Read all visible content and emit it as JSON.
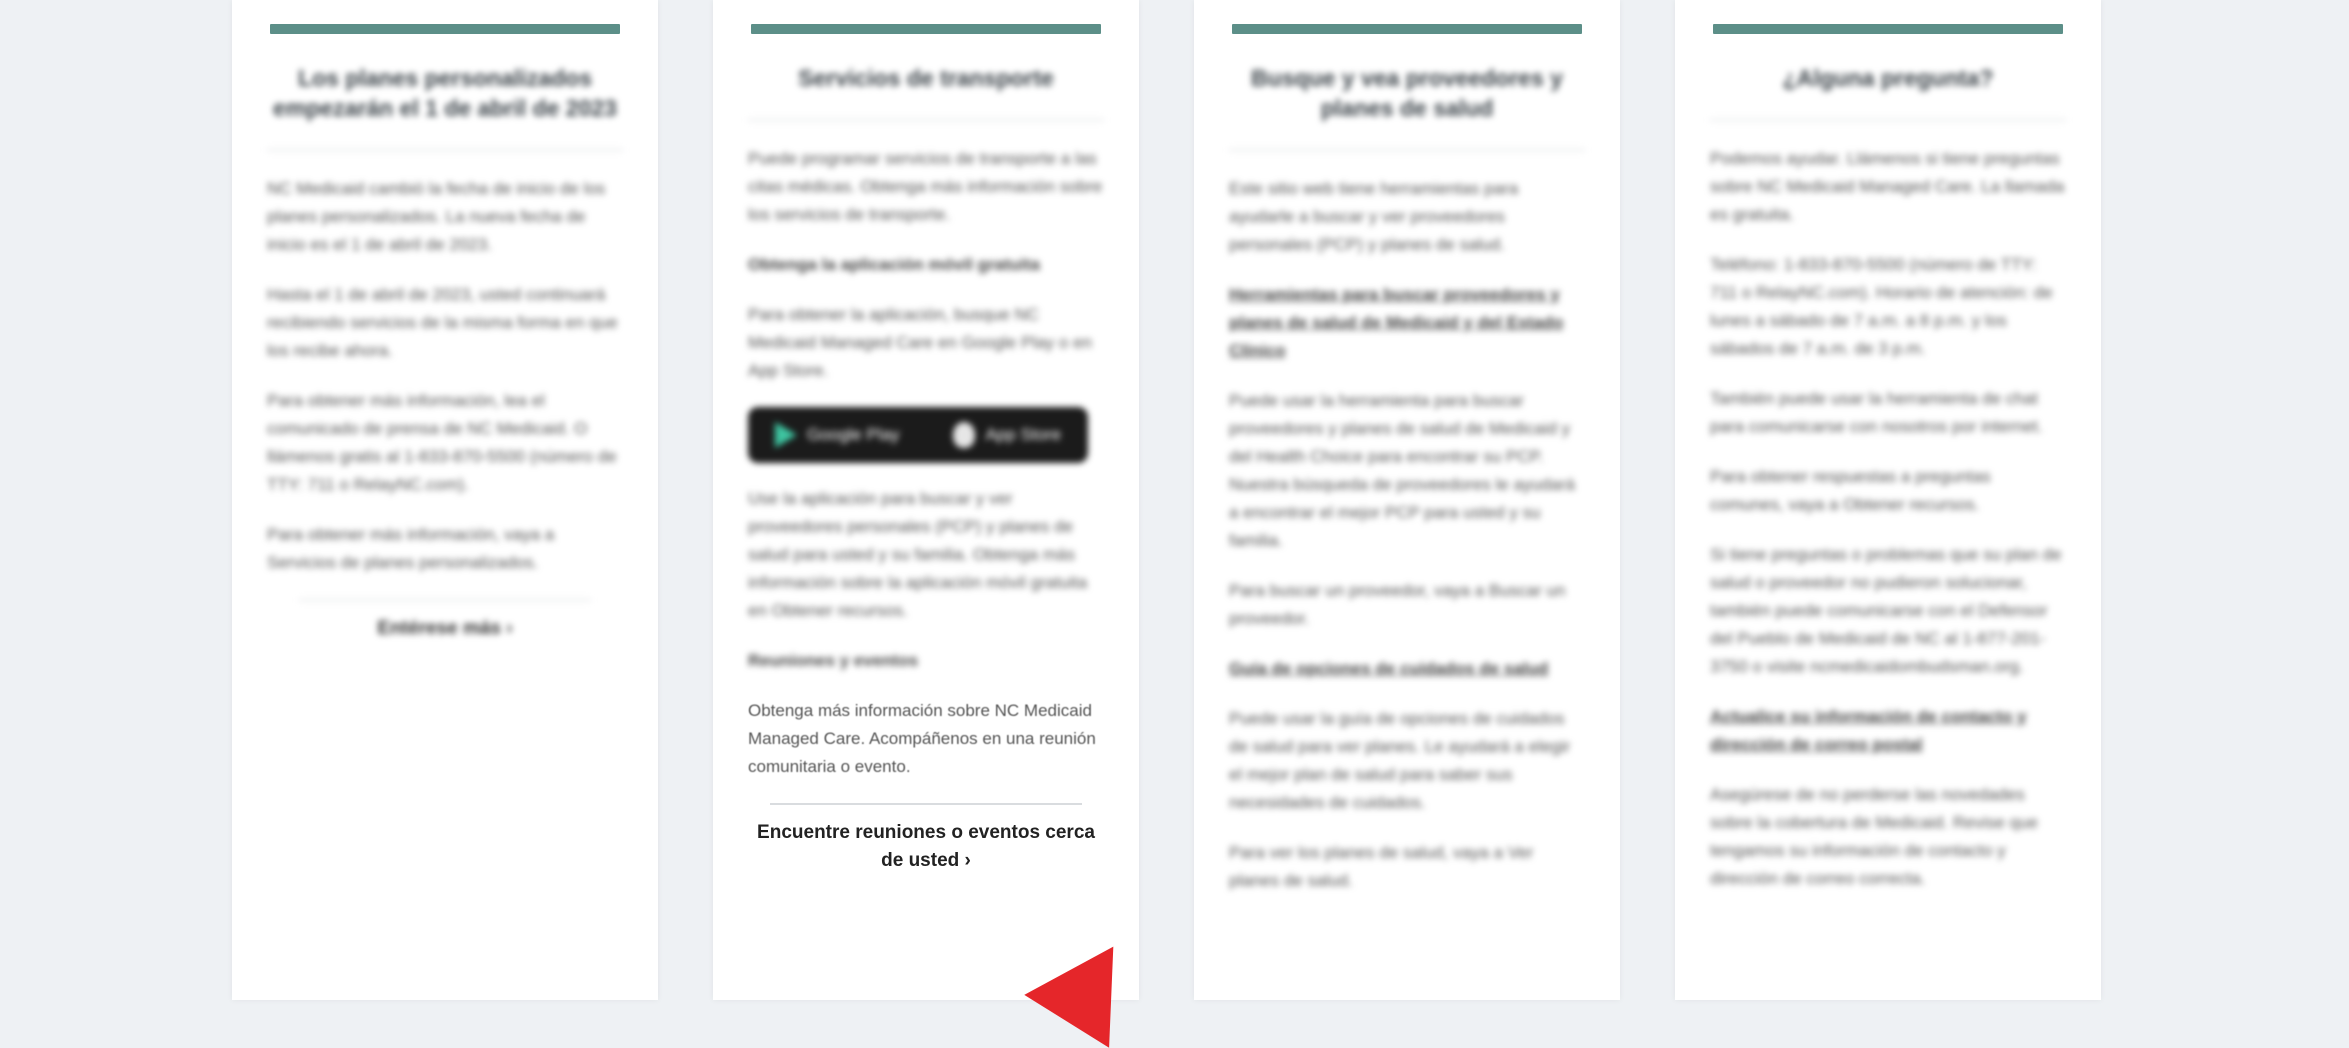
{
  "card1": {
    "title": "Los planes personalizados empezarán el 1 de abril de 2023",
    "p1": "NC Medicaid cambió la fecha de inicio de los planes personalizados. La nueva fecha de inicio es el 1 de abril de 2023.",
    "p2": "Hasta el 1 de abril de 2023, usted continuará recibiendo servicios de la misma forma en que los recibe ahora.",
    "p3": "Para obtener más información, lea el comunicado de prensa de NC Medicaid. O llámenos gratis al 1-833-870-5500 (número de TTY: 711 o RelayNC.com).",
    "p4": "Para obtener más información, vaya a Servicios de planes personalizados.",
    "more": "Entérese más ›"
  },
  "card2": {
    "title": "Servicios de transporte",
    "p1": "Puede programar servicios de transporte a las citas médicas. Obtenga más información sobre los servicios de transporte.",
    "h1": "Obtenga la aplicación móvil gratuita",
    "p2": "Para obtener la aplicación, busque NC Medicaid Managed Care en Google Play o en App Store.",
    "store_google": "Google Play",
    "store_apple": "App Store",
    "p3": "Use la aplicación para buscar y ver proveedores personales (PCP) y planes de salud para usted y su familia. Obtenga más información sobre la aplicación móvil gratuita en Obtener recursos.",
    "h2": "Reuniones y eventos",
    "p4": "Obtenga más información sobre NC Medicaid Managed Care. Acompáñenos en una reunión comunitaria o evento.",
    "cta": "Encuentre reuniones o eventos cerca de usted ›"
  },
  "card3": {
    "title": "Busque y vea proveedores y planes de salud",
    "p1": "Este sitio web tiene herramientas para ayudarle a buscar y ver proveedores personales (PCP) y planes de salud.",
    "h1": "Herramientas para buscar proveedores y planes de salud de Medicaid y del Estado Clínico",
    "p2": "Puede usar la herramienta para buscar proveedores y planes de salud de Medicaid y del Health Choice para encontrar su PCP. Nuestra búsqueda de proveedores le ayudará a encontrar el mejor PCP para usted y su familia.",
    "p3": "Para buscar un proveedor, vaya a Buscar un proveedor.",
    "h2": "Guía de opciones de cuidados de salud",
    "p4": "Puede usar la guía de opciones de cuidados de salud para ver planes. Le ayudará a elegir el mejor plan de salud para saber sus necesidades de cuidados.",
    "p5": "Para ver los planes de salud, vaya a Ver planes de salud."
  },
  "card4": {
    "title": "¿Alguna pregunta?",
    "p1": "Podemos ayudar. Llámenos si tiene preguntas sobre NC Medicaid Managed Care. La llamada es gratuita.",
    "p2": "Teléfono: 1-833-870-5500 (número de TTY: 711 o RelayNC.com). Horario de atención: de lunes a sábado de 7 a.m. a 8 p.m. y los sábados de 7 a.m. de 3 p.m.",
    "p3": "También puede usar la herramienta de chat para comunicarse con nosotros por internet.",
    "p4": "Para obtener respuestas a preguntas comunes, vaya a Obtener recursos.",
    "p5": "Si tiene preguntas o problemas que su plan de salud o proveedor no pudieron solucionar, también puede comunicarse con el Defensor del Pueblo de Medicaid de NC al 1-877-201-3750 o visite ncmedicaidombudsman.org.",
    "h1": "Actualice su información de contacto y dirección de correo postal",
    "p6": "Asegúrese de no perderse las novedades sobre la cobertura de Medicaid. Revise que tengamos su información de contacto y dirección de correo correcta."
  }
}
